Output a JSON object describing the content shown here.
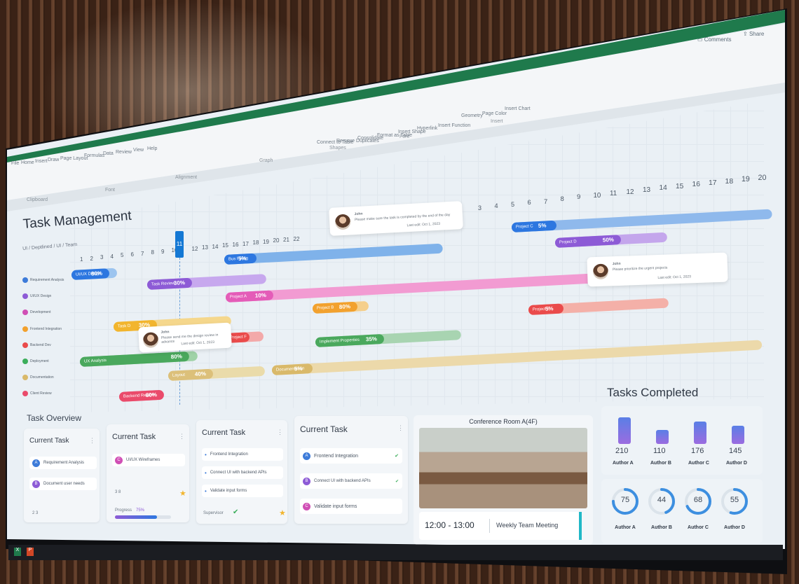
{
  "titlebar": {
    "comments_label": "Comments",
    "share_label": "Share"
  },
  "ribbon": {
    "tabs": [
      "File",
      "Home",
      "Insert",
      "Draw",
      "Page Layout",
      "Formulas",
      "Data",
      "Review",
      "View",
      "Help"
    ],
    "groups": [
      "Clipboard",
      "Font",
      "Alignment",
      "Graph",
      "Shapes",
      "Font",
      "Insert"
    ],
    "buttons": [
      "Connect to Table",
      "Remove Duplicates",
      "Consolidate",
      "Format as Table",
      "Insert Shape",
      "Hyperlink",
      "Insert Function",
      "Geometry",
      "Page Color",
      "Insert Chart"
    ]
  },
  "header": {
    "title": "Task Management",
    "breadcrumb": "UI / Deptlined / UI / Team"
  },
  "timeline": {
    "days_left": [
      "1",
      "2",
      "3",
      "4",
      "5",
      "6",
      "7",
      "8",
      "9",
      "10",
      "11",
      "12",
      "13",
      "14",
      "15",
      "16",
      "17",
      "18",
      "19",
      "20",
      "21",
      "22"
    ],
    "today": "11",
    "days_right": [
      "3",
      "4",
      "5",
      "6",
      "7",
      "8",
      "9",
      "10",
      "11",
      "12",
      "13",
      "14",
      "15",
      "16",
      "17",
      "18",
      "19",
      "20"
    ]
  },
  "sidebar": {
    "items": [
      {
        "label": "Requirement Analysis",
        "color": "#3d7bd9"
      },
      {
        "label": "UI/UX Design",
        "color": "#8d5bd6"
      },
      {
        "label": "Development",
        "color": "#d04fb5"
      },
      {
        "label": "Frontend Integration",
        "color": "#f2a12e"
      },
      {
        "label": "Backend Dev",
        "color": "#ea4b4b"
      },
      {
        "label": "Deployment",
        "color": "#3cae5b"
      },
      {
        "label": "Documentation",
        "color": "#d9b96a"
      },
      {
        "label": "Client Review",
        "color": "#ea4b6b"
      }
    ]
  },
  "bars": [
    {
      "label": "UI/UX Design",
      "pct": "80%",
      "color": "#2d77e0",
      "track": "#9cc4ef"
    },
    {
      "label": "Bus Fixing",
      "pct": "5%",
      "color": "#2d77e0",
      "track": "#7fb2ea"
    },
    {
      "label": "Task Review",
      "pct": "30%",
      "color": "#8d5bd6",
      "track": "#c7a8ee"
    },
    {
      "label": "Project A",
      "pct": "10%",
      "color": "#e45cb8",
      "track": "#f29bd2"
    },
    {
      "label": "Project B",
      "pct": "80%",
      "color": "#f2a12e",
      "track": "#f5cf8c"
    },
    {
      "label": "Task D",
      "pct": "30%",
      "color": "#f2b52e",
      "track": "#f5d78c"
    },
    {
      "label": "Project F",
      "pct": "",
      "color": "#ea4b4b",
      "track": "#f3a9a9"
    },
    {
      "label": "Implement Properties",
      "pct": "35%",
      "color": "#4aa85d",
      "track": "#a8d4b1"
    },
    {
      "label": "UX Analysis",
      "pct": "80%",
      "color": "#4aa85d",
      "track": "#9fd2a7"
    },
    {
      "label": "Layout",
      "pct": "40%",
      "color": "#dcc07a",
      "track": "#eadbaa"
    },
    {
      "label": "Documentation",
      "pct": "5%",
      "color": "#d9b96a",
      "track": "#ecd9aa"
    },
    {
      "label": "Backend Review",
      "pct": "80%",
      "color": "#ea4b6b",
      "track": "#f3a1b1"
    },
    {
      "label": "Project C",
      "pct": "5%",
      "color": "#2d77e0",
      "track": "#8fb9ec"
    },
    {
      "label": "Project D",
      "pct": "50%",
      "color": "#8d5bd6",
      "track": "#c4a6ec"
    },
    {
      "label": "Project E",
      "pct": "5%",
      "color": "#ea4b4b",
      "track": "#f4b0a8"
    }
  ],
  "comments": [
    {
      "name": "John",
      "text": "Please make sure the task is completed by the end of the day",
      "time": "Last edit: Oct 1, 2023"
    },
    {
      "name": "John",
      "text": "Please prioritize the urgent projects",
      "time": "Last edit: Oct 1, 2023"
    },
    {
      "name": "John",
      "text": "Please send me the design review in advance",
      "time": "Last edit: Oct 1, 2023"
    }
  ],
  "overview": {
    "title": "Task Overview",
    "cards": [
      {
        "title": "Current Task",
        "tasks": [
          {
            "letter": "A",
            "label": "Requirement Analysis",
            "color": "#3d7bd9"
          },
          {
            "letter": "B",
            "label": "Document user needs",
            "color": "#8d5bd6"
          }
        ],
        "icons_label": "2   3"
      },
      {
        "title": "Current Task",
        "tasks": [
          {
            "letter": "C",
            "label": "UI/UX Wireframes",
            "color": "#d04fb5"
          }
        ],
        "icons_label": "3   8",
        "progress_label": "Progress",
        "progress_value": "75%",
        "progress": 0.75
      },
      {
        "title": "Current Task",
        "tasks": [
          {
            "letter": "",
            "label": "Frontend Integration",
            "color": "#3d7bd9"
          },
          {
            "letter": "",
            "label": "Connect UI with backend APIs",
            "color": "#3d7bd9"
          },
          {
            "letter": "",
            "label": "Validate input forms",
            "color": "#3d7bd9"
          }
        ],
        "supervisor_label": "Supervisor"
      },
      {
        "title": "Current Task",
        "tasks": [
          {
            "letter": "A",
            "label": "Frontend Integration",
            "color": "#3d7bd9"
          },
          {
            "letter": "B",
            "label": "Connect UI with backend APIs",
            "color": "#8d5bd6"
          },
          {
            "letter": "C",
            "label": "Validate input forms",
            "color": "#d04fb5"
          }
        ]
      }
    ]
  },
  "conference": {
    "title": "Conference Room A(4F)",
    "time": "12:00 - 13:00",
    "event": "Weekly Team Meeting"
  },
  "tasks_completed": {
    "title": "Tasks Completed",
    "bars": [
      {
        "value": "210",
        "author": "Author A",
        "frac": 1.0
      },
      {
        "value": "110",
        "author": "Author B",
        "frac": 0.52
      },
      {
        "value": "176",
        "author": "Author C",
        "frac": 0.84
      },
      {
        "value": "145",
        "author": "Author D",
        "frac": 0.69
      }
    ],
    "rings": [
      {
        "value": "75",
        "author": "Author A",
        "frac": 0.75
      },
      {
        "value": "44",
        "author": "Author B",
        "frac": 0.44
      },
      {
        "value": "68",
        "author": "Author C",
        "frac": 0.68
      },
      {
        "value": "55",
        "author": "Author D",
        "frac": 0.55
      }
    ]
  }
}
